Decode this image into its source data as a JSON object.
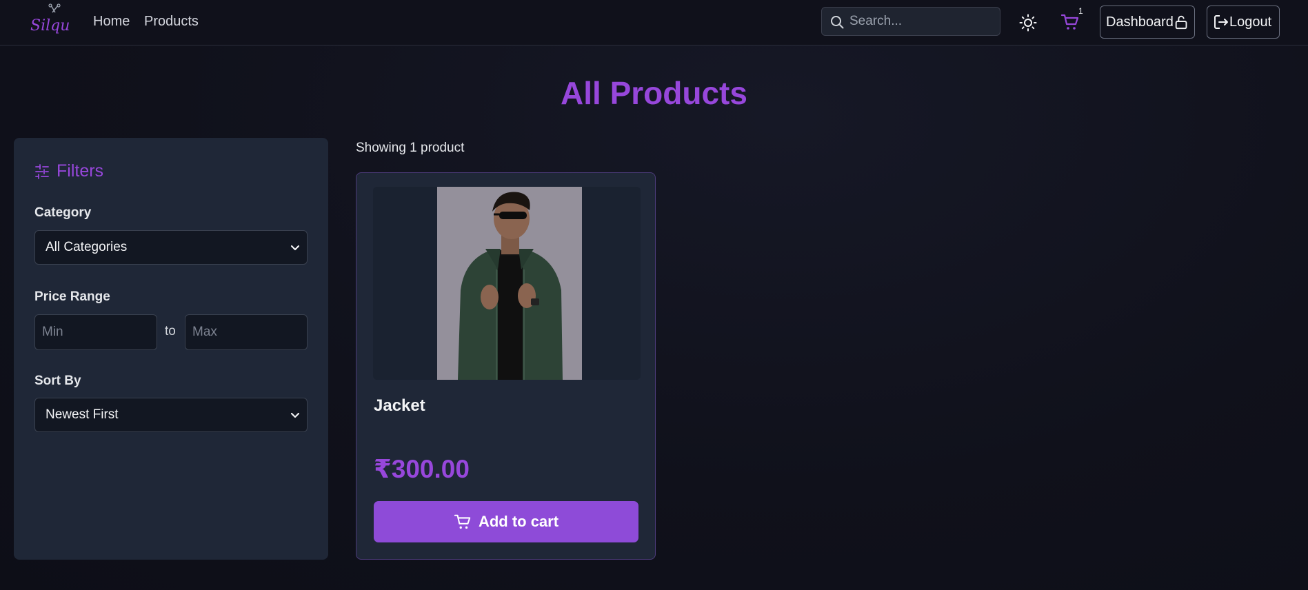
{
  "navbar": {
    "logo_text": "Silque",
    "links": [
      {
        "label": "Home"
      },
      {
        "label": "Products"
      }
    ],
    "search": {
      "placeholder": "Search..."
    },
    "cart_count": "1",
    "dashboard_label": "Dashboard",
    "logout_label": "Logout",
    "icons": [
      "search-icon",
      "sun-icon",
      "cart-icon",
      "lock-icon",
      "logout-icon"
    ]
  },
  "page": {
    "title": "All Products"
  },
  "filters": {
    "heading": "Filters",
    "category": {
      "label": "Category",
      "selected": "All Categories"
    },
    "price": {
      "label": "Price Range",
      "min_placeholder": "Min",
      "max_placeholder": "Max",
      "separator": "to"
    },
    "sort": {
      "label": "Sort By",
      "selected": "Newest First"
    }
  },
  "results": {
    "count_text": "Showing 1 product",
    "products": [
      {
        "name": "Jacket",
        "price": "₹300.00",
        "add_label": "Add to cart"
      }
    ]
  },
  "colors": {
    "accent": "#9747db",
    "button": "#8e4bd8",
    "panel": "#1f2737",
    "background": "#10111b"
  }
}
